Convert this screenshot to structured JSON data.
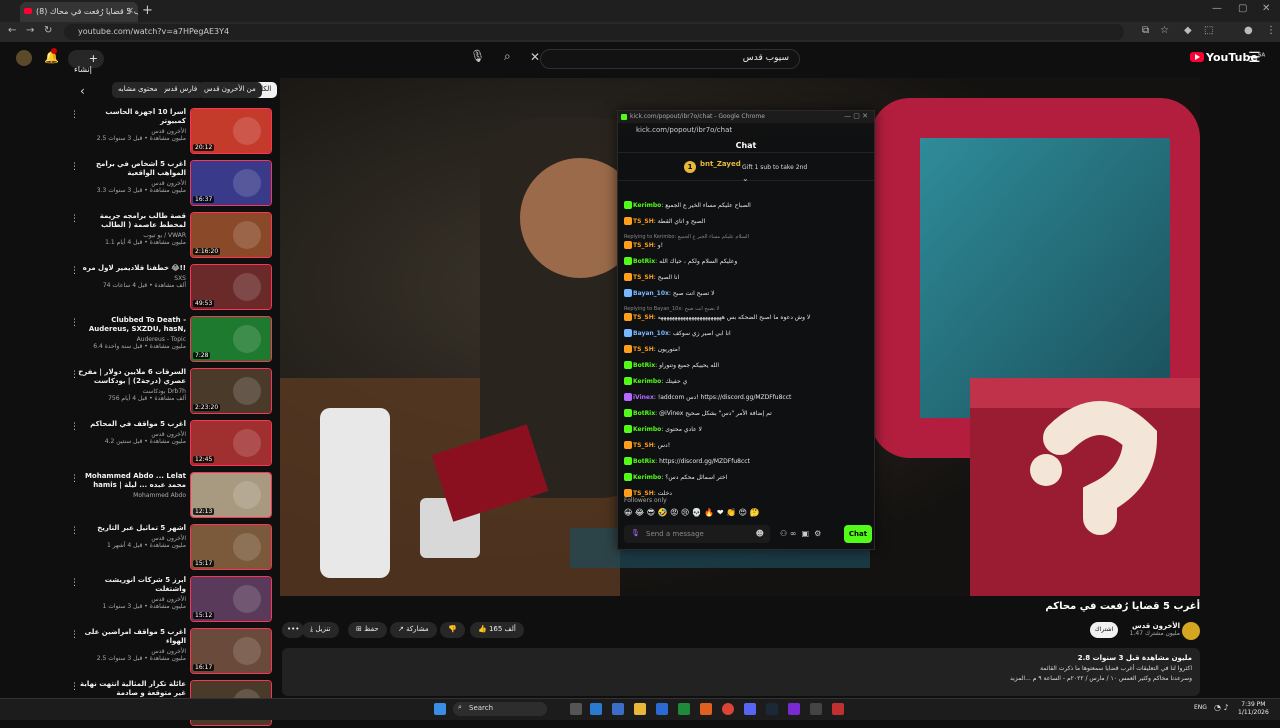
{
  "browser": {
    "tab_title": "(8) أغرب 5 قضايا رُفعت في محاك...",
    "tab_close": "×",
    "new_tab": "+",
    "url": "youtube.com/watch?v=a7HPegAE3Y4",
    "window_controls": [
      "—",
      "▢",
      "✕"
    ]
  },
  "header": {
    "logo": "YouTube",
    "logo_sup": "SA",
    "search_value": "سيوب قدس",
    "create_label": "إنشاء"
  },
  "chips": [
    "الكل",
    "من الأخرون قدس",
    "فارس قدس",
    "محتوى مشابه"
  ],
  "recommended": [
    {
      "title": "أسرا 10 أجهزة الحاسب كمبيوتر",
      "channel": "الأخرون قدس",
      "stats": "2.5 مليون مشاهدة • قبل 3 سنوات",
      "duration": "20:12",
      "thumb": "#c43a2b"
    },
    {
      "title": "أغرب 5 أشخاص في برامج المواهب الواقعية",
      "channel": "الأخرون قدس",
      "stats": "3.3 مليون مشاهدة • قبل 3 سنوات",
      "duration": "16:37",
      "thumb": "#3a3a8a"
    },
    {
      "title": "قصة طالب برامجه جريمة لمخطط عاصمة ( الطالب المغرور ) (",
      "channel": "يو تيوب / VWAR",
      "stats": "1.1 مليون مشاهدة • قبل 4 أيام",
      "duration": "2:16:20",
      "thumb": "#8a4a2a"
    },
    {
      "title": "خطفنا فلاديمير لاول مره 😂!!",
      "channel": "SXS",
      "stats": "74 ألف مشاهدة • قبل 4 ساعات",
      "duration": "49:53",
      "thumb": "#6a2a2a"
    },
    {
      "title": "Clubbed To Death - Audereus, SXZDU, hasN, Lythx, sixzee, ...",
      "channel": "Audereus - Topic",
      "stats": "6.4 مليون مشاهدة • قبل سنة واحدة",
      "duration": "7:28",
      "thumb": "#1e7a2e"
    },
    {
      "title": "السرقات 6 ملايين دولار | مفرح عصري (درجة2) | بودكاست يصور خير",
      "channel": "بودكاست Drb7h",
      "stats": "756 ألف مشاهدة • قبل 4 أيام",
      "duration": "2:23:20",
      "thumb": "#4a3a2a"
    },
    {
      "title": "أغرب 5 مواقف في المحاكم",
      "channel": "الأخرون قدس",
      "stats": "4.2 مليون مشاهدة • قبل سنتين",
      "duration": "12:45",
      "thumb": "#a03030"
    },
    {
      "title": "Mohammed Abdo ... Lelat hamis | محمد عبده ... ليلة خميس - حفل",
      "channel": "Mohammed Abdo",
      "stats": "",
      "duration": "12:13",
      "thumb": "#a89a80"
    },
    {
      "title": "أشهر 5 تماثيل عبر التاريخ",
      "channel": "الأخرون قدس",
      "stats": "1 مليون مشاهدة • قبل 4 أشهر",
      "duration": "15:17",
      "thumb": "#7a5a3a"
    },
    {
      "title": "أبرز 5 شركات أنوريشت واشتغلت",
      "channel": "الأخرون قدس",
      "stats": "1 مليون مشاهدة • قبل 3 سنوات",
      "duration": "15:12",
      "thumb": "#5a3a5a"
    },
    {
      "title": "أغرب 5 مواقف امراضين على الهواء",
      "channel": "الأخرون قدس",
      "stats": "2.5 مليون مشاهدة • قبل 3 سنوات",
      "duration": "16:17",
      "thumb": "#6a4a3a"
    },
    {
      "title": "عائلة تكرار المثالية انتهت نهاية غير متوقعة و صادمة",
      "channel": "",
      "stats": "",
      "duration": "",
      "thumb": "#4a3a2a"
    }
  ],
  "chat": {
    "window_title": "kick.com/popout/ibr7o/chat - Google Chrome",
    "url": "kick.com/popout/ibr7o/chat",
    "header": "Chat",
    "pinned_user": "bnt_Zayed",
    "pinned_count": "1",
    "gift_text": "Gift 1 sub to take 2nd",
    "messages": [
      {
        "user": "Kerimbo",
        "color": "#53fc18",
        "text": "الصباح عليكم مساء الخير ع الجميع",
        "reply": ""
      },
      {
        "user": "TS_SH",
        "color": "#ff9f1c",
        "text": "الصبح و اتاي القطة",
        "reply": ""
      },
      {
        "user": "TS_SH",
        "color": "#ff9f1c",
        "text": "و!",
        "reply": "Replying to Kerimbo: السلام عليكم مساء الخير ع الجميع"
      },
      {
        "user": "BotRix",
        "color": "#53fc18",
        "text": "وعليكم السلام ولكم ، حياك الله",
        "reply": ""
      },
      {
        "user": "TS_SH",
        "color": "#ff9f1c",
        "text": "انا الصبح",
        "reply": ""
      },
      {
        "user": "Bayan_10x",
        "color": "#79b8ff",
        "text": "لا تصبح انت صبح",
        "reply": ""
      },
      {
        "user": "TS_SH",
        "color": "#ff9f1c",
        "text": "لا وش دعوه ما اصبح الضحكه بس هههههههههههههههههههههههه",
        "reply": "Replying to Bayan_10x: لا تصبح انت صبح"
      },
      {
        "user": "Bayan_10x",
        "color": "#79b8ff",
        "text": "انا ابي اصير زي سوكف",
        "reply": ""
      },
      {
        "user": "TS_SH",
        "color": "#ff9f1c",
        "text": "متوريون!",
        "reply": ""
      },
      {
        "user": "BotRix",
        "color": "#53fc18",
        "text": "الله يحييكم جميع وتنوراو",
        "reply": ""
      },
      {
        "user": "Kerimbo",
        "color": "#53fc18",
        "text": "ي حفيتك",
        "reply": ""
      },
      {
        "user": "iVinex",
        "color": "#b36bff",
        "text": "!addcom دس! https://discord.gg/MZDFfu8cct",
        "reply": ""
      },
      {
        "user": "BotRix",
        "color": "#53fc18",
        "text": "@iVinex تم إضافة الأمر \"دس\" بشكل صحيح",
        "reply": ""
      },
      {
        "user": "Kerimbo",
        "color": "#53fc18",
        "text": "لا عادي محتوى",
        "reply": ""
      },
      {
        "user": "TS_SH",
        "color": "#ff9f1c",
        "text": "دس!",
        "reply": ""
      },
      {
        "user": "BotRix",
        "color": "#53fc18",
        "text": "https://discord.gg/MZDFfu8cct",
        "reply": ""
      },
      {
        "user": "Kerimbo",
        "color": "#53fc18",
        "text": "اختر اسمائل محكم دس؟",
        "reply": ""
      },
      {
        "user": "TS_SH",
        "color": "#ff9f1c",
        "text": "دخلت",
        "reply": ""
      }
    ],
    "followers_only": "Followers only",
    "emotes": "😀 😂 😎 🤣 😡 😢 💀 🔥 ❤ 👏 😍 🤔",
    "input_placeholder": "Send a message",
    "send_label": "Chat"
  },
  "video_info": {
    "title": "أغرب 5 قضايا رُفعت في محاكم",
    "channel": "الأخرون قدس",
    "subscribers": "1.47 مليون مشترك",
    "join": "اشتراك",
    "likes": "165 ألف",
    "share": "مشاركة",
    "save": "حفظ",
    "download": "تنزيل",
    "more": "•••",
    "desc_stats": "2.8 مليون مشاهدة  قبل 3 سنوات",
    "desc_line1": "اكثروا لنا في التعليقات أغرب قضايا سمعتوها ما ذكرت القائمة",
    "desc_line2": "وسرعدنا محاكم وكثير العمس ١٠ / مارس / ٢٠٢٢م - الساعة ٩ م ...المزيد"
  },
  "taskbar": {
    "search": "Search",
    "lang": "ENG",
    "time": "7:39 PM",
    "date": "1/11/2026"
  }
}
